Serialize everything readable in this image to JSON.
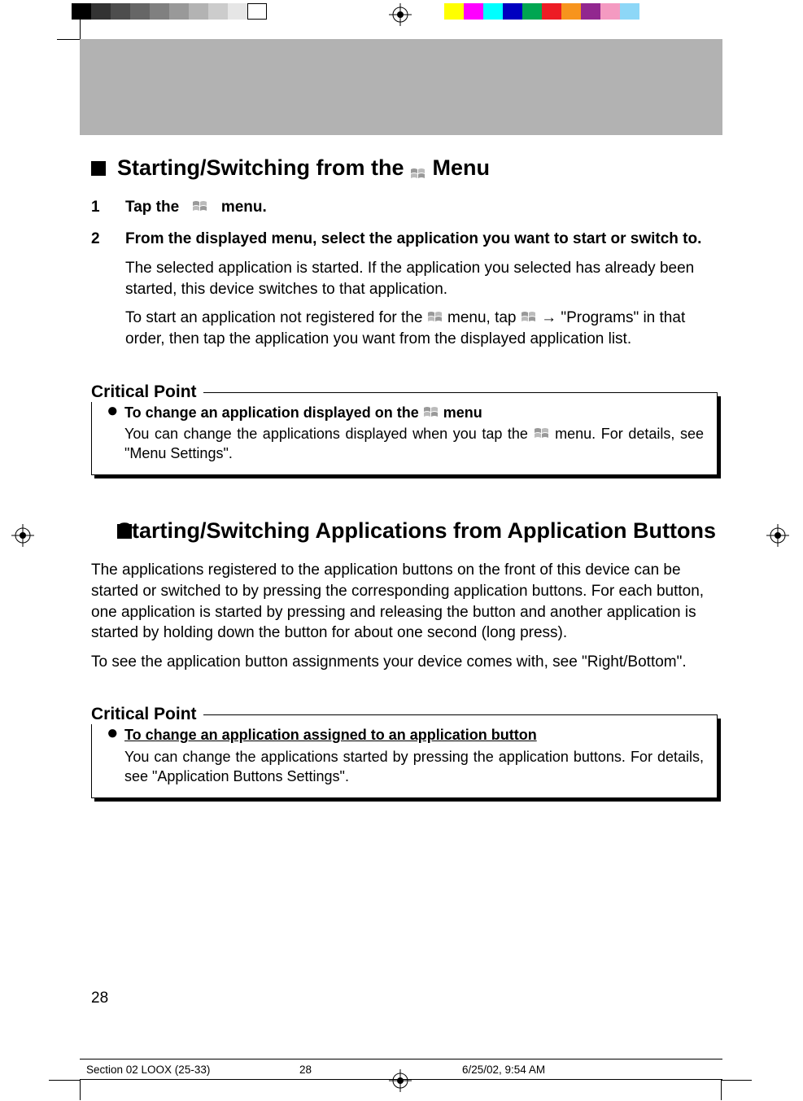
{
  "section1": {
    "heading_pre": "Starting/Switching from the",
    "heading_post": "Menu",
    "step1_num": "1",
    "step1_text": "Tap the",
    "step1_text2": "menu.",
    "step2_num": "2",
    "step2_bold": "From the displayed menu, select the application you want to start or switch to.",
    "step2_p1": "The selected application is started. If the application you selected has already been started, this device switches to that application.",
    "step2_p2a": "To start an application not registered for the",
    "step2_p2b": "menu, tap",
    "step2_p2c": "→ \"Programs\" in that order, then tap the application you want from the displayed application list."
  },
  "cp1": {
    "label": "Critical Point",
    "hd_a": "To change an application displayed on the",
    "hd_b": "menu",
    "bd_a": "You can change the applications displayed when you tap the",
    "bd_b": "menu. For details, see \"Menu Settings\"."
  },
  "section2": {
    "heading": "Starting/Switching Applications from Application Buttons",
    "p1": "The applications registered to the application buttons on the front of this device can be started or switched to by pressing the corresponding application buttons. For each button, one application is started by pressing and releasing the button and another application is started by holding down the button for about one second (long press).",
    "p2": "To see the application button assignments your device comes with, see \"Right/Bottom\"."
  },
  "cp2": {
    "label": "Critical Point",
    "hd": "To change an application assigned to an application button",
    "bd": "You can change the applications started by pressing the application buttons. For details, see \"Application Buttons Settings\"."
  },
  "page_number": "28",
  "footer": {
    "section": "Section 02 LOOX (25-33)",
    "page": "28",
    "datetime": "6/25/02, 9:54 AM"
  },
  "color_bar1": [
    "#000000",
    "#333333",
    "#4d4d4d",
    "#666666",
    "#808080",
    "#999999",
    "#b3b3b3",
    "#cccccc",
    "#e6e6e6",
    "#ffffff"
  ],
  "color_bar2": [
    "#ffff00",
    "#ff00ff",
    "#00ffff",
    "#0000ff",
    "#00a651",
    "#ed1c24",
    "#f7941d",
    "#92278f",
    "#f49ac1",
    "#8dd7f7"
  ]
}
